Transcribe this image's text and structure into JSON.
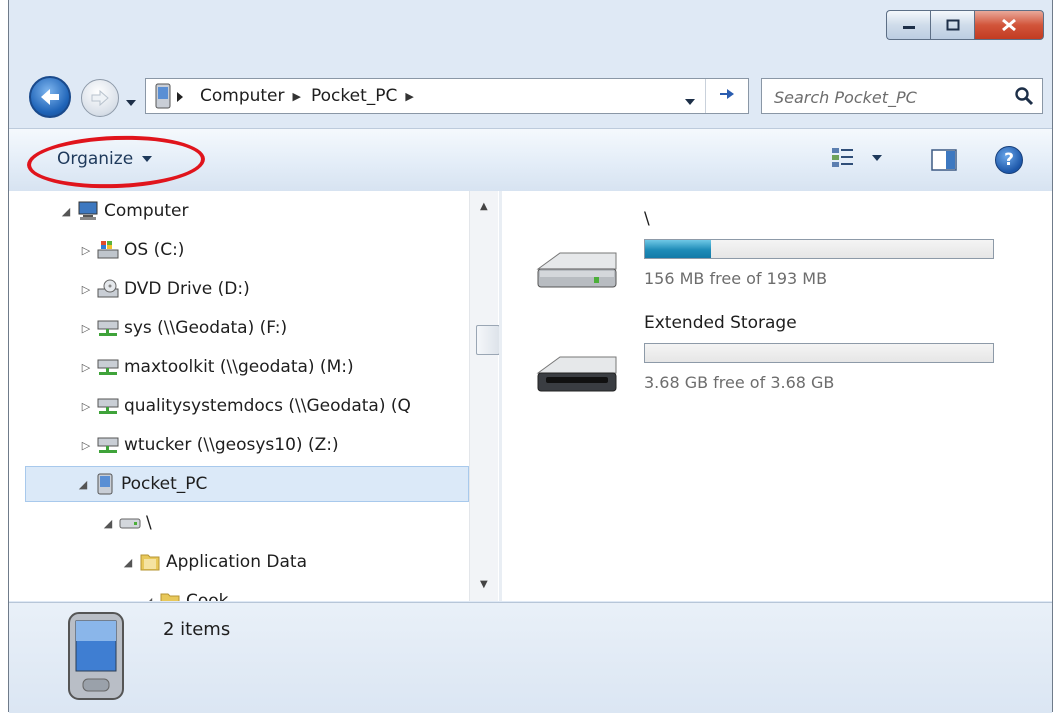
{
  "address": {
    "crumbs": [
      "Computer",
      "Pocket_PC"
    ]
  },
  "search": {
    "placeholder": "Search Pocket_PC"
  },
  "toolbar": {
    "organize_label": "Organize"
  },
  "tree": [
    {
      "label": "Computer",
      "icon": "computer-icon",
      "expander": "expanded"
    },
    {
      "label": "OS (C:)",
      "icon": "os-drive-icon",
      "expander": "collapsed"
    },
    {
      "label": "DVD Drive (D:)",
      "icon": "dvd-drive-icon",
      "expander": "collapsed"
    },
    {
      "label": "sys (\\\\Geodata) (F:)",
      "icon": "network-drive-icon",
      "expander": "collapsed"
    },
    {
      "label": "maxtoolkit (\\\\geodata) (M:)",
      "icon": "network-drive-icon",
      "expander": "collapsed"
    },
    {
      "label": "qualitysystemdocs (\\\\Geodata) (Q",
      "icon": "network-drive-icon",
      "expander": "collapsed"
    },
    {
      "label": "wtucker (\\\\geosys10) (Z:)",
      "icon": "network-drive-icon",
      "expander": "collapsed"
    },
    {
      "label": "Pocket_PC",
      "icon": "pocket-pc-icon",
      "expander": "expanded",
      "selected": true
    },
    {
      "label": "\\",
      "icon": "storage-drive-icon",
      "expander": "expanded"
    },
    {
      "label": "Application Data",
      "icon": "folder-icon",
      "expander": "expanded"
    },
    {
      "label": "Cook...",
      "icon": "folder-icon",
      "expander": "expanded"
    }
  ],
  "drives": [
    {
      "name": "\\",
      "free_text": "156 MB free of 193 MB",
      "used_fraction": 0.19
    },
    {
      "name": "Extended Storage",
      "free_text": "3.68 GB free of 3.68 GB",
      "used_fraction": 0.0
    }
  ],
  "details": {
    "items_count": "2 items"
  },
  "colors": {
    "annotation_circle": "#e0141c",
    "usage_bar": "#1f8cb8",
    "selection": "#dbe9f8"
  }
}
